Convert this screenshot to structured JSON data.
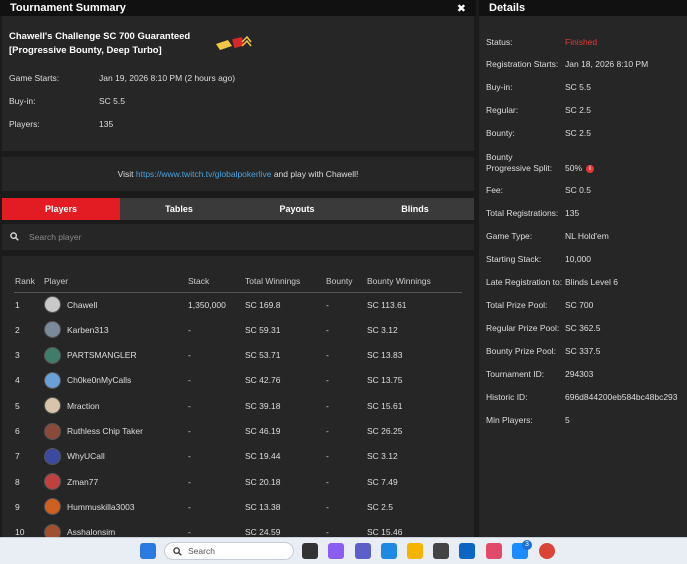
{
  "summary": {
    "header": "Tournament Summary",
    "close_glyph": "✖",
    "tournament_name": "Chawell's Challenge SC 700 Guaranteed [Progressive Bounty, Deep Turbo]",
    "rows": [
      {
        "label": "Game Starts:",
        "value": "Jan 19, 2026 8:10 PM (2 hours ago)"
      },
      {
        "label": "Buy-in:",
        "value": "SC 5.5"
      },
      {
        "label": "Players:",
        "value": "135"
      }
    ]
  },
  "visit": {
    "pre": "Visit ",
    "link": "https://www.twitch.tv/globalpokerlive",
    "post": " and play with Chawell!"
  },
  "tabs": [
    {
      "label": "Players",
      "active": true
    },
    {
      "label": "Tables",
      "active": false
    },
    {
      "label": "Payouts",
      "active": false
    },
    {
      "label": "Blinds",
      "active": false
    }
  ],
  "search": {
    "placeholder": "Search player"
  },
  "table": {
    "headers": {
      "rank": "Rank",
      "player": "Player",
      "stack": "Stack",
      "total": "Total Winnings",
      "bounty": "Bounty",
      "bounty_winnings": "Bounty Winnings"
    },
    "rows": [
      {
        "rank": "1",
        "player": "Chawell",
        "stack": "1,350,000",
        "total": "SC 169.8",
        "bounty": "-",
        "bounty_winnings": "SC 113.61",
        "avatar_color": "#c9c9c9"
      },
      {
        "rank": "2",
        "player": "Karben313",
        "stack": "-",
        "total": "SC 59.31",
        "bounty": "-",
        "bounty_winnings": "SC 3.12",
        "avatar_color": "#7a8a9a"
      },
      {
        "rank": "3",
        "player": "PARTSMANGLER",
        "stack": "-",
        "total": "SC 53.71",
        "bounty": "-",
        "bounty_winnings": "SC 13.83",
        "avatar_color": "#3f7d6a"
      },
      {
        "rank": "4",
        "player": "Ch0ke0nMyCalls",
        "stack": "-",
        "total": "SC 42.76",
        "bounty": "-",
        "bounty_winnings": "SC 13.75",
        "avatar_color": "#6aa0d8"
      },
      {
        "rank": "5",
        "player": "Mraction",
        "stack": "-",
        "total": "SC 39.18",
        "bounty": "-",
        "bounty_winnings": "SC 15.61",
        "avatar_color": "#d8c4a8"
      },
      {
        "rank": "6",
        "player": "Ruthless Chip Taker",
        "stack": "-",
        "total": "SC 46.19",
        "bounty": "-",
        "bounty_winnings": "SC 26.25",
        "avatar_color": "#8a4a3a"
      },
      {
        "rank": "7",
        "player": "WhyUCall",
        "stack": "-",
        "total": "SC 19.44",
        "bounty": "-",
        "bounty_winnings": "SC 3.12",
        "avatar_color": "#3a4aa0"
      },
      {
        "rank": "8",
        "player": "Zman77",
        "stack": "-",
        "total": "SC 20.18",
        "bounty": "-",
        "bounty_winnings": "SC 7.49",
        "avatar_color": "#c04040"
      },
      {
        "rank": "9",
        "player": "Hummuskilla3003",
        "stack": "-",
        "total": "SC 13.38",
        "bounty": "-",
        "bounty_winnings": "SC 2.5",
        "avatar_color": "#d06020"
      },
      {
        "rank": "10",
        "player": "Asshalonsim",
        "stack": "-",
        "total": "SC 24.59",
        "bounty": "-",
        "bounty_winnings": "SC 15.46",
        "avatar_color": "#a05030"
      }
    ]
  },
  "details": {
    "header": "Details",
    "rows": [
      {
        "label": "Status:",
        "value": "Finished",
        "highlight": true
      },
      {
        "label": "Registration Starts:",
        "value": "Jan 18, 2026 8:10 PM"
      },
      {
        "label": "Buy-in:",
        "value": "SC 5.5"
      },
      {
        "label": "Regular:",
        "value": "SC 2.5"
      },
      {
        "label": "Bounty:",
        "value": "SC 2.5"
      },
      {
        "label": "Bounty Progressive Split:",
        "value": "50%",
        "info": "i"
      },
      {
        "label": "Fee:",
        "value": "SC 0.5"
      },
      {
        "label": "Total Registrations:",
        "value": "135"
      },
      {
        "label": "Game Type:",
        "value": "NL Hold'em"
      },
      {
        "label": "Starting Stack:",
        "value": "10,000"
      },
      {
        "label": "Late Registration to:",
        "value": "Blinds Level 6"
      },
      {
        "label": "Total Prize Pool:",
        "value": "SC 700"
      },
      {
        "label": "Regular Prize Pool:",
        "value": "SC 362.5"
      },
      {
        "label": "Bounty Prize Pool:",
        "value": "SC 337.5"
      },
      {
        "label": "Tournament ID:",
        "value": "294303"
      },
      {
        "label": "Historic ID:",
        "value": "696d844200eb584bc48bc293"
      },
      {
        "label": "Min Players:",
        "value": "5"
      }
    ]
  },
  "taskbar": {
    "search_label": "Search",
    "badge_count": "3",
    "icons": [
      "windows-start-icon",
      "task-view-icon",
      "copilot-icon",
      "teams-icon",
      "edge-icon",
      "file-explorer-icon",
      "store-icon",
      "outlook-icon",
      "photos-icon",
      "messenger-icon",
      "chrome-icon"
    ],
    "accent": "#e31b23"
  }
}
